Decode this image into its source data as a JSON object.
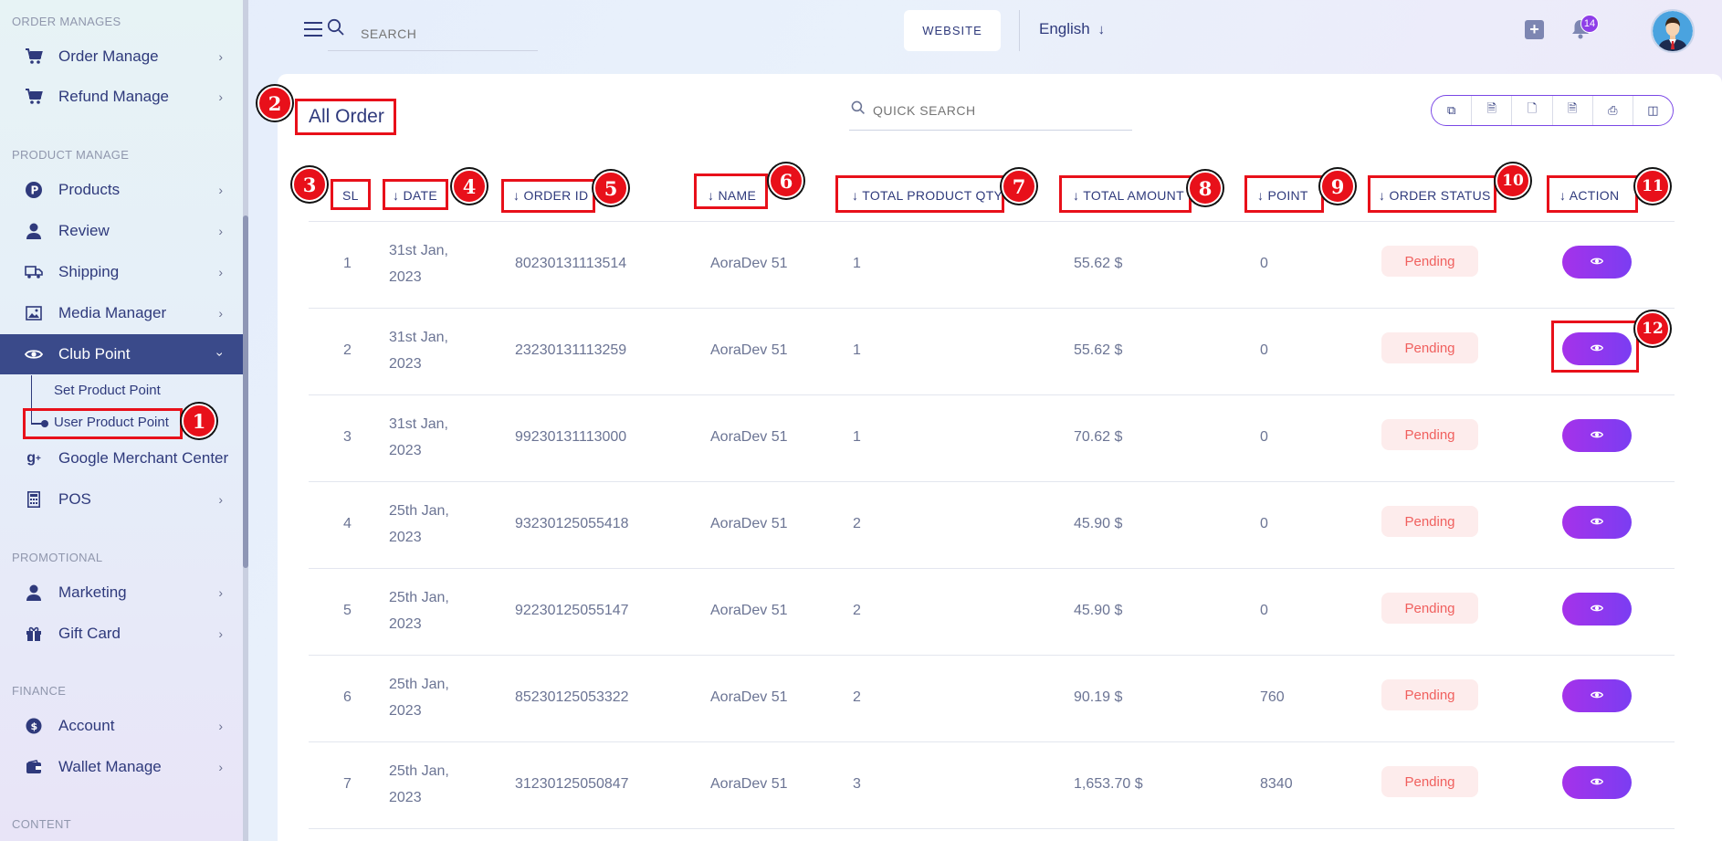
{
  "sidebar": {
    "sections": {
      "order_manages": "ORDER MANAGES",
      "product_manage": "PRODUCT MANAGE",
      "promotional": "PROMOTIONAL",
      "finance": "FINANCE",
      "content": "CONTENT"
    },
    "items": {
      "order_manage": "Order Manage",
      "refund_manage": "Refund Manage",
      "products": "Products",
      "review": "Review",
      "shipping": "Shipping",
      "media_manager": "Media Manager",
      "club_point": "Club Point",
      "set_product_point": "Set Product Point",
      "user_product_point": "User Product Point",
      "google_merchant_center": "Google Merchant Center",
      "pos": "POS",
      "marketing": "Marketing",
      "gift_card": "Gift Card",
      "account": "Account",
      "wallet_manage": "Wallet Manage"
    }
  },
  "topbar": {
    "search_placeholder": "SEARCH",
    "website_label": "WEBSITE",
    "language": "English",
    "notification_count": "14"
  },
  "main": {
    "title": "All Order",
    "quick_search_placeholder": "QUICK SEARCH",
    "columns": {
      "sl": "SL",
      "date": "DATE",
      "order_id": "ORDER ID",
      "name": "NAME",
      "total_product_qty": "TOTAL PRODUCT QTY",
      "total_amount": "TOTAL AMOUNT",
      "point": "POINT",
      "order_status": "ORDER STATUS",
      "action": "ACTION"
    },
    "rows": [
      {
        "sl": "1",
        "date1": "31st Jan,",
        "date2": "2023",
        "order_id": "80230131113514",
        "name": "AoraDev 51",
        "qty": "1",
        "amount": "55.62 $",
        "point": "0",
        "status": "Pending"
      },
      {
        "sl": "2",
        "date1": "31st Jan,",
        "date2": "2023",
        "order_id": "23230131113259",
        "name": "AoraDev 51",
        "qty": "1",
        "amount": "55.62 $",
        "point": "0",
        "status": "Pending"
      },
      {
        "sl": "3",
        "date1": "31st Jan,",
        "date2": "2023",
        "order_id": "99230131113000",
        "name": "AoraDev 51",
        "qty": "1",
        "amount": "70.62 $",
        "point": "0",
        "status": "Pending"
      },
      {
        "sl": "4",
        "date1": "25th Jan,",
        "date2": "2023",
        "order_id": "93230125055418",
        "name": "AoraDev 51",
        "qty": "2",
        "amount": "45.90 $",
        "point": "0",
        "status": "Pending"
      },
      {
        "sl": "5",
        "date1": "25th Jan,",
        "date2": "2023",
        "order_id": "92230125055147",
        "name": "AoraDev 51",
        "qty": "2",
        "amount": "45.90 $",
        "point": "0",
        "status": "Pending"
      },
      {
        "sl": "6",
        "date1": "25th Jan,",
        "date2": "2023",
        "order_id": "85230125053322",
        "name": "AoraDev 51",
        "qty": "2",
        "amount": "90.19 $",
        "point": "760",
        "status": "Pending"
      },
      {
        "sl": "7",
        "date1": "25th Jan,",
        "date2": "2023",
        "order_id": "31230125050847",
        "name": "AoraDev 51",
        "qty": "3",
        "amount": "1,653.70 $",
        "point": "8340",
        "status": "Pending"
      }
    ]
  },
  "markers": [
    "1",
    "2",
    "3",
    "4",
    "5",
    "6",
    "7",
    "8",
    "9",
    "10",
    "11",
    "12"
  ],
  "colors": {
    "accent": "#3a4a8a",
    "marker": "#e8101a",
    "view_button": "#8e3ee8",
    "pending_bg": "#fdecec",
    "pending_text": "#f0605e"
  }
}
